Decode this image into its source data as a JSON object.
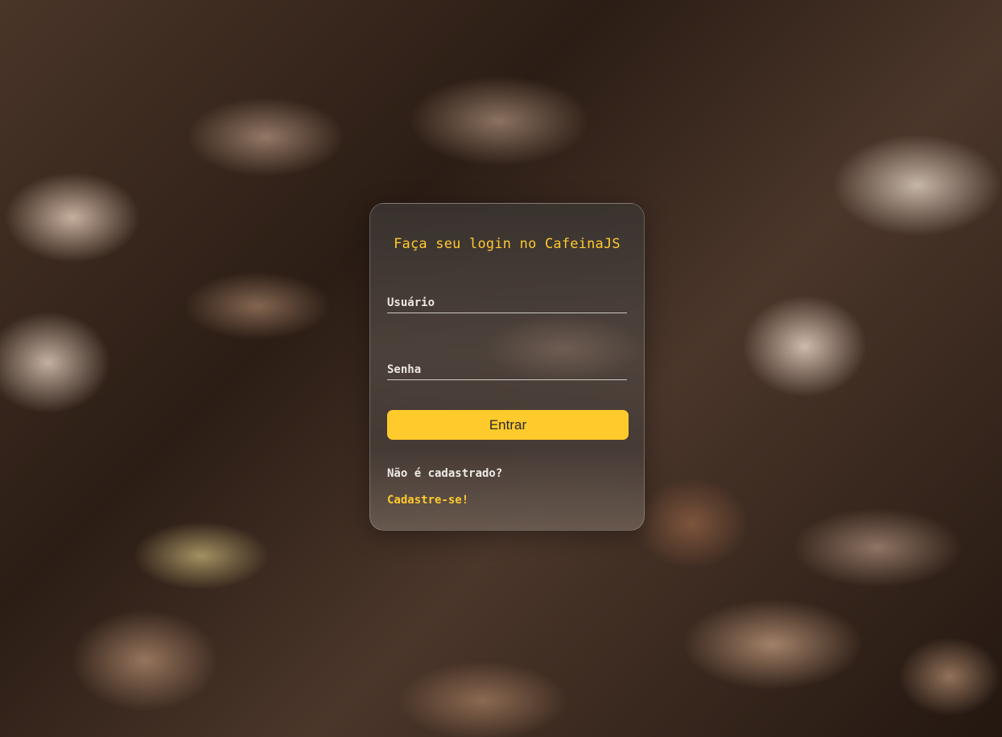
{
  "login": {
    "title": "Faça seu login no CafeinaJS",
    "username_placeholder": "Usuário",
    "username_value": "",
    "password_placeholder": "Senha",
    "password_value": "",
    "submit_label": "Entrar",
    "signup_prompt": "Não é cadastrado?",
    "signup_link": "Cadastre-se!"
  },
  "colors": {
    "accent": "#ffc930",
    "button": "#ffca2c",
    "card": "#4a423d"
  },
  "background": {
    "description_icon": "coffee-beans-photo"
  }
}
